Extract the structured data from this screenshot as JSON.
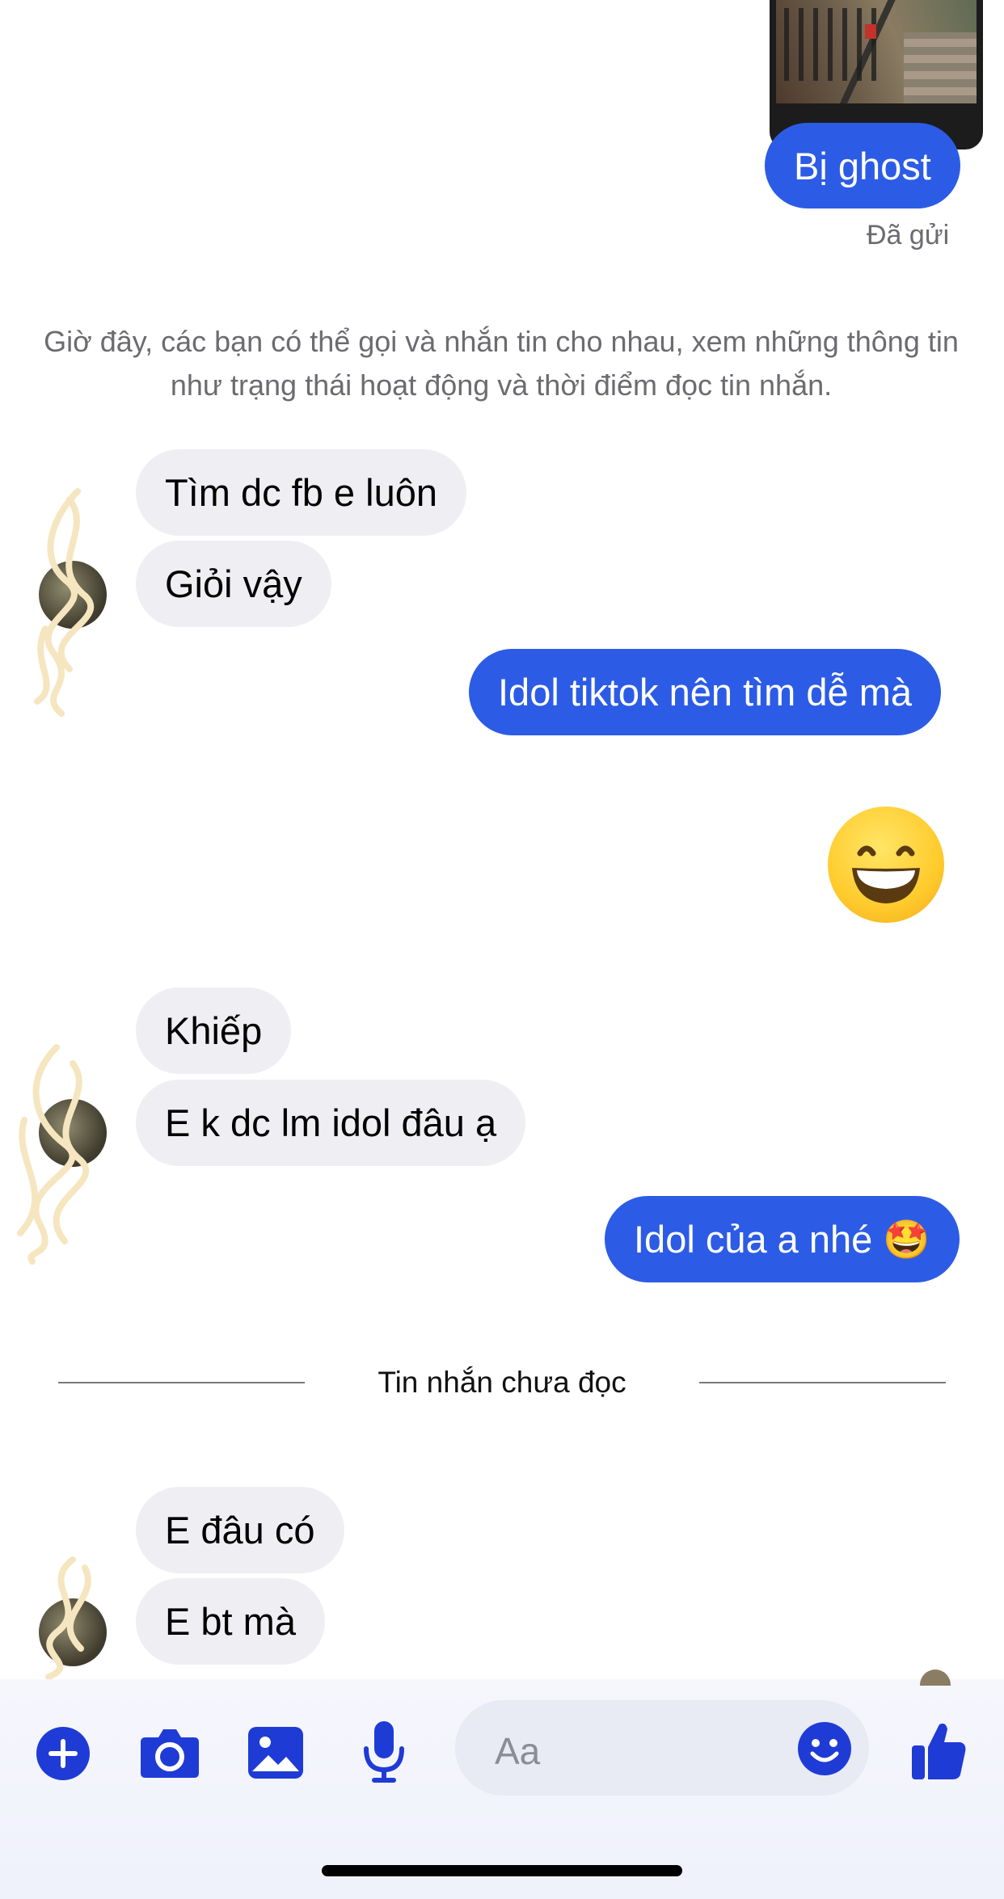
{
  "chat": {
    "top_media": {
      "name": "photo-attachment"
    },
    "status_sent": "Đã gửi",
    "system_notice": "Giờ đây, các bạn có thể gọi và nhắn tin cho nhau, xem những thông tin như trạng thái hoạt động và thời điểm đọc tin nhắn.",
    "unread_divider": "Tin nhắn chưa đọc",
    "messages": [
      {
        "from": "me",
        "text": "Bị ghost"
      },
      {
        "from": "them",
        "text": "Tìm dc fb e luôn"
      },
      {
        "from": "them",
        "text": "Giỏi vậy"
      },
      {
        "from": "me",
        "text": "Idol tiktok nên tìm dễ mà"
      },
      {
        "from": "me",
        "text": "😁",
        "type": "emoji-large"
      },
      {
        "from": "them",
        "text": "Khiếp"
      },
      {
        "from": "them",
        "text": "E k dc lm idol đâu ạ"
      },
      {
        "from": "me",
        "text": "Idol của a nhé 🤩"
      },
      {
        "from": "them",
        "text": "E đâu có"
      },
      {
        "from": "them",
        "text": "E bt mà"
      }
    ]
  },
  "composer": {
    "placeholder": "Aa",
    "icons": [
      "add-icon",
      "camera-icon",
      "image-icon",
      "microphone-icon",
      "smiley-icon",
      "thumbs-up-icon"
    ]
  },
  "colors": {
    "outgoing_bubble": "#2c5ce6",
    "incoming_bubble": "#efeff3",
    "icon_accent": "#1f3bd6"
  }
}
